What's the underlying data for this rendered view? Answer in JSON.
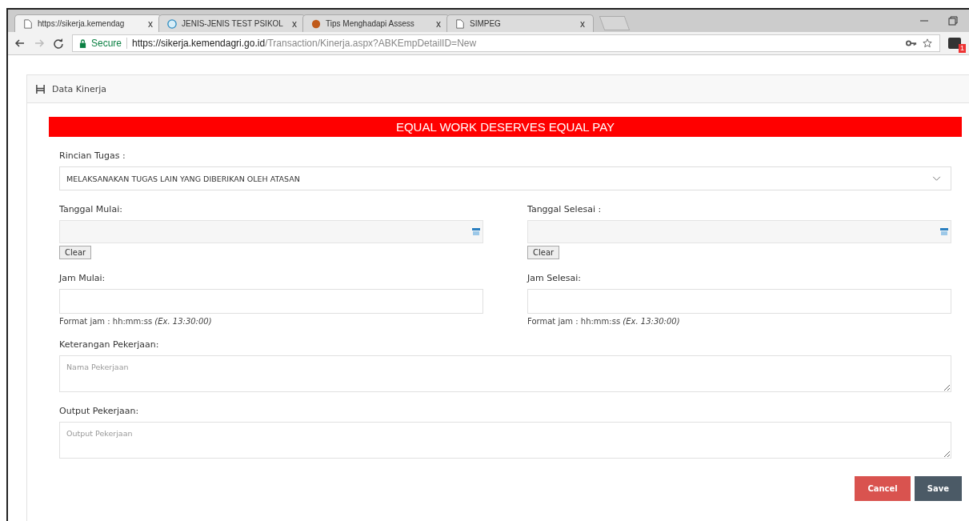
{
  "browser": {
    "tabs": [
      {
        "title": "https://sikerja.kemendag",
        "close": "x",
        "kind": "page",
        "selected": true
      },
      {
        "title": "JENIS-JENIS TEST PSIKOL",
        "close": "x",
        "kind": "globe",
        "selected": false
      },
      {
        "title": "Tips Menghadapi Assess",
        "close": "x",
        "kind": "site",
        "selected": false
      },
      {
        "title": "SIMPEG",
        "close": "x",
        "kind": "page",
        "selected": false
      }
    ],
    "secure_label": "Secure",
    "url_host": "https://sikerja.kemendagri.go.id",
    "url_path": "/Transaction/Kinerja.aspx?ABKEmpDetailID=New",
    "extension_badge": "1"
  },
  "panel": {
    "title": "Data Kinerja",
    "banner": "EQUAL WORK DESERVES EQUAL PAY",
    "task": {
      "label": "Rincian Tugas :",
      "value": "MELAKSANAKAN TUGAS LAIN YANG DIBERIKAN OLEH ATASAN"
    },
    "dates": [
      {
        "label": "Tanggal Mulai:",
        "button": "Clear"
      },
      {
        "label": "Tanggal Selesai :",
        "button": "Clear"
      }
    ],
    "times": [
      {
        "label": "Jam Mulai:",
        "hint": "Format jam : hh:mm:ss",
        "example": "(Ex. 13:30:00)"
      },
      {
        "label": "Jam Selesai:",
        "hint": "Format jam : hh:mm:ss",
        "example": "(Ex. 13:30:00)"
      }
    ],
    "textareas": [
      {
        "label": "Keterangan Pekerjaan:",
        "placeholder": "Nama Pekerjaan"
      },
      {
        "label": "Output Pekerjaan:",
        "placeholder": "Output Pekerjaan"
      }
    ],
    "buttons": [
      {
        "label": "Cancel",
        "kind": "danger"
      },
      {
        "label": "Save",
        "kind": "primary"
      }
    ]
  }
}
